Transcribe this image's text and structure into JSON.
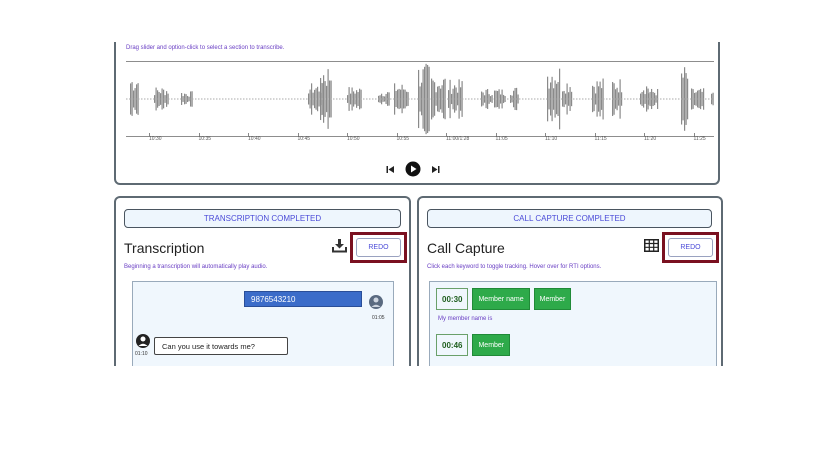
{
  "waveform": {
    "hint": "Drag slider and option-click to select a section to transcribe.",
    "ticks": [
      "10:30",
      "10:35",
      "10:40",
      "10:45",
      "10:50",
      "10:55",
      "11:00/1:28",
      "11:05",
      "11:10",
      "11:15",
      "11:20",
      "11:25"
    ]
  },
  "transcription": {
    "status": "TRANSCRIPTION COMPLETED",
    "title": "Transcription",
    "redo_label": "REDO",
    "hint": "Beginning a transcription will automatically play audio.",
    "messages": [
      {
        "text": "9876543210",
        "time": "01:05"
      },
      {
        "text": "Can you use it towards me?",
        "time": "01:10"
      }
    ]
  },
  "call_capture": {
    "status": "CALL CAPTURE COMPLETED",
    "title": "Call Capture",
    "redo_label": "REDO",
    "hint": "Click each keyword to toggle tracking. Hover over for RTI options.",
    "rows": [
      {
        "time": "00:30",
        "keywords": [
          "Member name",
          "Member"
        ]
      },
      {
        "time": "00:46",
        "keywords": [
          "Member"
        ]
      }
    ],
    "note": "My member name is"
  },
  "icons": {
    "prev": "skip-back-icon",
    "play": "play-icon",
    "next": "skip-forward-icon",
    "download": "download-icon",
    "table": "table-icon"
  },
  "colors": {
    "accent": "#4b4bd8",
    "hint": "#6a3fc4",
    "highlight_border": "#7a1020",
    "keyword": "#2eaa4a",
    "agent_bubble": "#3b6cc9"
  }
}
